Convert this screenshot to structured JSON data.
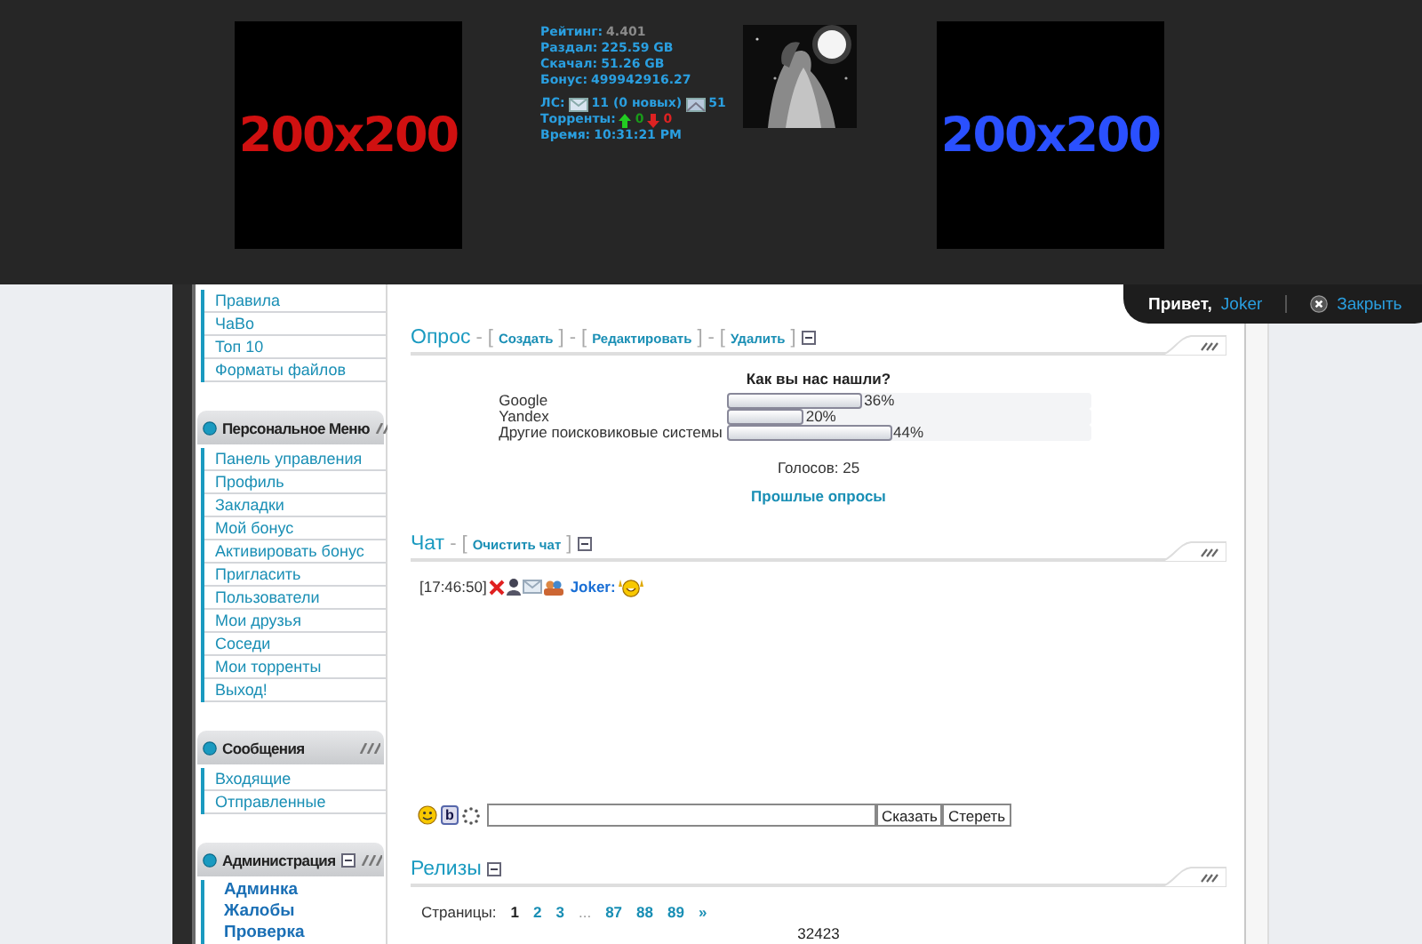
{
  "header": {
    "banners": [
      {
        "text": "200x200",
        "color": "#d01010"
      },
      {
        "text": "200x200",
        "color": "#2a50ff"
      }
    ],
    "stats": [
      {
        "label": "Рейтинг:",
        "value": "4.401",
        "color": "#8a8a8a"
      },
      {
        "label": "Раздал:",
        "value": "225.59 GB",
        "color": "#2a9fe0"
      },
      {
        "label": "Скачал:",
        "value": "51.26 GB",
        "color": "#2a9fe0"
      },
      {
        "label": "Бонус:",
        "value": "499942916.27",
        "color": "#2a9fe0"
      }
    ],
    "messages": {
      "label": "ЛС:",
      "inbox": "11 (0 новых)",
      "sent": "51"
    },
    "torrents": {
      "label": "Торренты:",
      "seeding": "0",
      "leeching": "0"
    },
    "time": {
      "label": "Время:",
      "value": "10:31:21 PM"
    }
  },
  "welcome": {
    "greeting": "Привет,",
    "user": "Joker",
    "close": "Закрыть"
  },
  "sidebar": [
    {
      "kind": "menu",
      "items": [
        "Правила",
        "ЧаВо",
        "Топ 10",
        "Форматы файлов"
      ]
    },
    {
      "kind": "menu",
      "title": "Персональное Меню",
      "items": [
        "Панель управления",
        "Профиль",
        "Закладки",
        "Мой бонус",
        "Активировать бонус",
        "Пригласить",
        "Пользователи",
        "Мои друзья",
        "Соседи",
        "Мои торренты",
        "Выход!"
      ]
    },
    {
      "kind": "menu",
      "title": "Сообщения",
      "items": [
        "Входящие",
        "Отправленные"
      ]
    },
    {
      "kind": "admin",
      "title": "Администрация",
      "collapsible": true,
      "items": [
        "Админка",
        "Жалобы",
        "Проверка"
      ]
    }
  ],
  "poll": {
    "title": "Опрос",
    "separator": "-",
    "open": "[",
    "close": "]",
    "actions": [
      "Создать",
      "Редактировать",
      "Удалить"
    ],
    "question": "Как вы нас нашли?",
    "options": [
      {
        "label": "Google",
        "level": 0.36,
        "percent": "36%"
      },
      {
        "label": "Yandex",
        "level": 0.2,
        "percent": "20%"
      },
      {
        "label": "Другие поисковиковые системы",
        "level": 0.44,
        "percent": "44%"
      }
    ],
    "votes": "Голосов: 25",
    "past": "Прошлые опросы"
  },
  "chat": {
    "title": "Чат",
    "separator": "-",
    "open": "[",
    "close": "]",
    "actions": [
      "Очистить чат"
    ],
    "messages": [
      {
        "time": "[17:46:50]",
        "user": "Joker:"
      }
    ],
    "bold": "b",
    "buttons": [
      "Сказать",
      "Стереть"
    ]
  },
  "releases": {
    "title": "Релизы",
    "pages_label": "Страницы:",
    "pages": [
      {
        "label": "1",
        "kind": "page",
        "selected": true
      },
      {
        "label": "2",
        "kind": "page",
        "selected": false
      },
      {
        "label": "3",
        "kind": "page",
        "selected": false
      },
      {
        "label": "...",
        "kind": "gap",
        "selected": false
      },
      {
        "label": "87",
        "kind": "page",
        "selected": false
      },
      {
        "label": "88",
        "kind": "page",
        "selected": false
      },
      {
        "label": "89",
        "kind": "page",
        "selected": false
      },
      {
        "label": "»",
        "kind": "page",
        "selected": false
      }
    ],
    "first_item": "32423"
  }
}
